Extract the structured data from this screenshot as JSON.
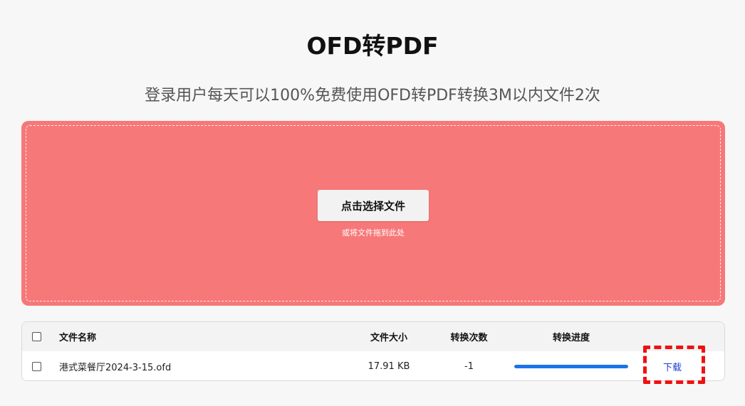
{
  "page": {
    "title": "OFD转PDF",
    "subtitle": "登录用户每天可以100%免费使用OFD转PDF转换3M以内文件2次"
  },
  "upload": {
    "button_label": "点击选择文件",
    "hint": "或将文件拖到此处",
    "background_color": "#f77878"
  },
  "table": {
    "headers": {
      "name": "文件名称",
      "size": "文件大小",
      "count": "转换次数",
      "progress": "转换进度"
    },
    "rows": [
      {
        "name": "港式菜餐厅2024-3-15.ofd",
        "size": "17.91 KB",
        "count": "-1",
        "progress": 100,
        "action": "下载"
      }
    ]
  },
  "colors": {
    "progress": "#1a73e8",
    "link": "#1a3fd1",
    "highlight": "#ee1111"
  }
}
